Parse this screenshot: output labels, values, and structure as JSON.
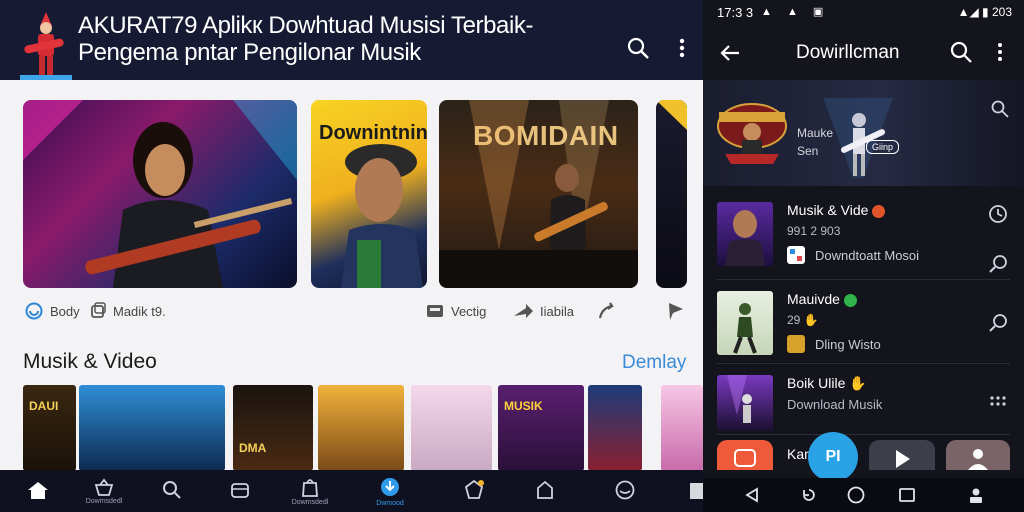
{
  "left": {
    "header": {
      "title_line1": "AKURAT79 Aplikк Dowhtuad Musisi Terbaik-",
      "title_line2": "Pengema  pntar Pengilonar Musik"
    },
    "featured": {
      "card2_text": "Downintnin",
      "card3_text": "BOMIDAIN"
    },
    "actions": [
      {
        "label": "Body",
        "icon": "refresh-icon"
      },
      {
        "label": "Madik t9.",
        "icon": "copy-icon"
      },
      {
        "label": "Vectig",
        "icon": "tray-icon"
      },
      {
        "label": "Iiabila",
        "icon": "share-icon"
      },
      {
        "label": "",
        "icon": "reply-icon"
      },
      {
        "label": "",
        "icon": "flag-icon"
      }
    ],
    "section": {
      "title": "Musik & Video",
      "link": "Demlay"
    },
    "thumbs": [
      {
        "text": "DAUI"
      },
      {
        "text": ""
      },
      {
        "text": "DMA"
      },
      {
        "text": ""
      },
      {
        "text": ""
      },
      {
        "text": "MUSIK"
      },
      {
        "text": ""
      },
      {
        "text": ""
      }
    ],
    "bottom_nav": [
      {
        "label": "",
        "icon": "home-icon"
      },
      {
        "label": "Dowmsdedl",
        "icon": "basket-icon"
      },
      {
        "label": "",
        "icon": "search-icon"
      },
      {
        "label": "",
        "icon": "box-icon"
      },
      {
        "label": "Dowmsdedl",
        "icon": "bag-icon"
      },
      {
        "label": "Dwmood",
        "icon": "download-icon"
      },
      {
        "label": "",
        "icon": "badge-icon"
      },
      {
        "label": "",
        "icon": "home-outline-icon"
      },
      {
        "label": "",
        "icon": "chat-icon"
      }
    ]
  },
  "right": {
    "status": {
      "time": "17:3 3",
      "icons": "▲ ▲ ▣",
      "right": "▲◢ ▮ 203"
    },
    "top": {
      "title": "Dowirllcman"
    },
    "banner": {
      "line1": "Mauke",
      "line2": "Sen",
      "tag": "Giinp"
    },
    "items": [
      {
        "title": "Musik & Vide",
        "sub": "991 2 903",
        "sub2": "Downdtoatt Mosoi"
      },
      {
        "title": "Mauivde",
        "sub": "29 ",
        "sub2": "Dling Wisto"
      },
      {
        "title": "Boik Ulile",
        "sub": "Download Musik",
        "sub2": ""
      },
      {
        "title": "Kam",
        "sub": "",
        "sub2": ""
      }
    ],
    "fab_label": "PI"
  },
  "colors": {
    "accent": "#2aa3e6",
    "header": "#161a33",
    "link": "#3a8bd9"
  }
}
